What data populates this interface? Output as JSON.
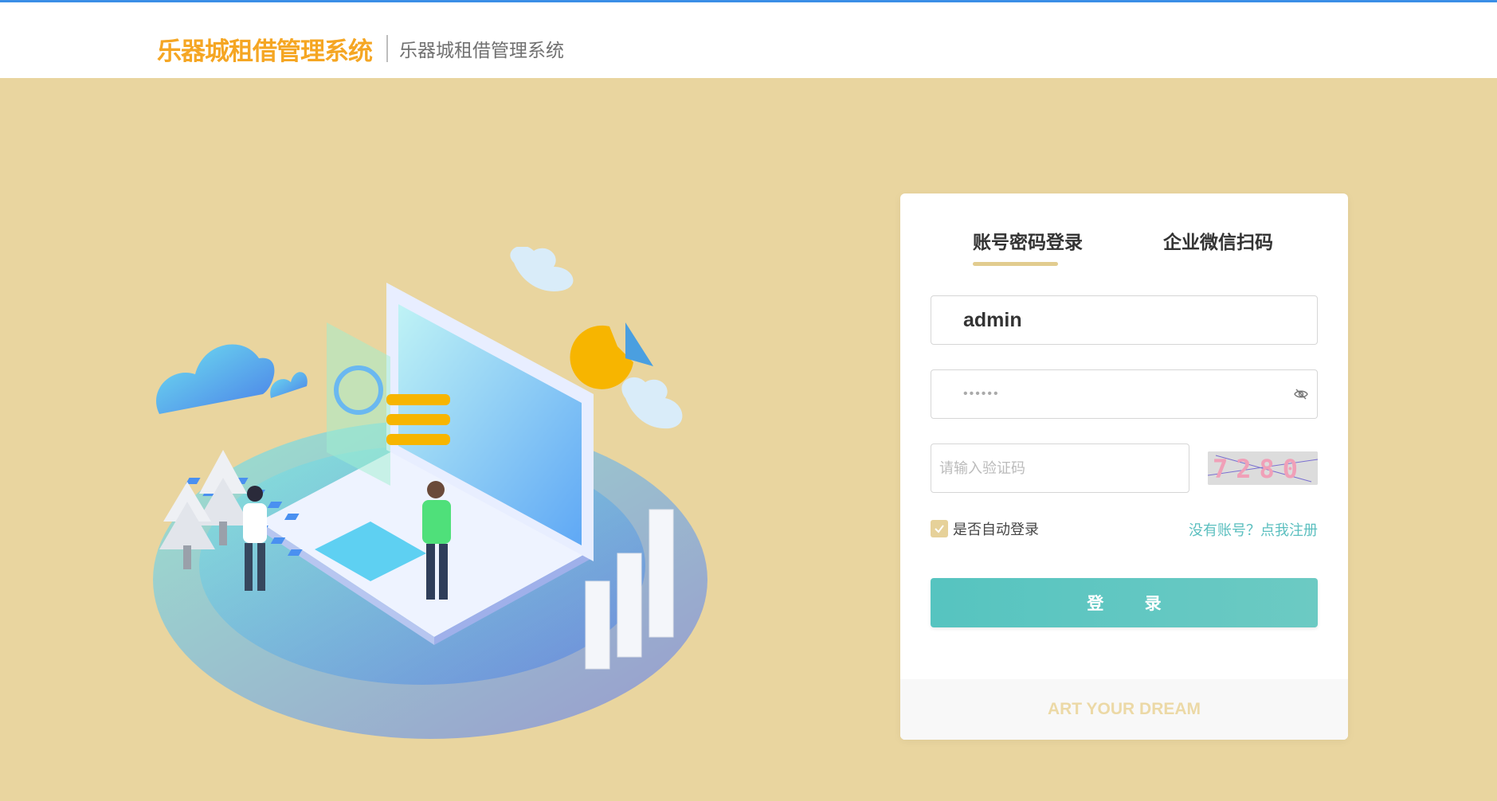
{
  "header": {
    "logo_text": "乐器城租借管理系统",
    "subtitle": "乐器城租借管理系统"
  },
  "login": {
    "tabs": [
      {
        "label": "账号密码登录",
        "active": true
      },
      {
        "label": "企业微信扫码",
        "active": false
      }
    ],
    "username_value": "admin",
    "password_value": "••••••",
    "captcha_placeholder": "请输入验证码",
    "captcha_text": "7280",
    "remember_label": "是否自动登录",
    "remember_checked": true,
    "register_link": "没有账号？点我注册",
    "login_button": "登 录",
    "footer_slogan": "ART YOUR DREAM"
  },
  "colors": {
    "background": "#e9d59f",
    "header_accent": "#3a8ee6",
    "logo": "#f5a623",
    "button": "#56c4c0",
    "link": "#5bbfbf"
  }
}
